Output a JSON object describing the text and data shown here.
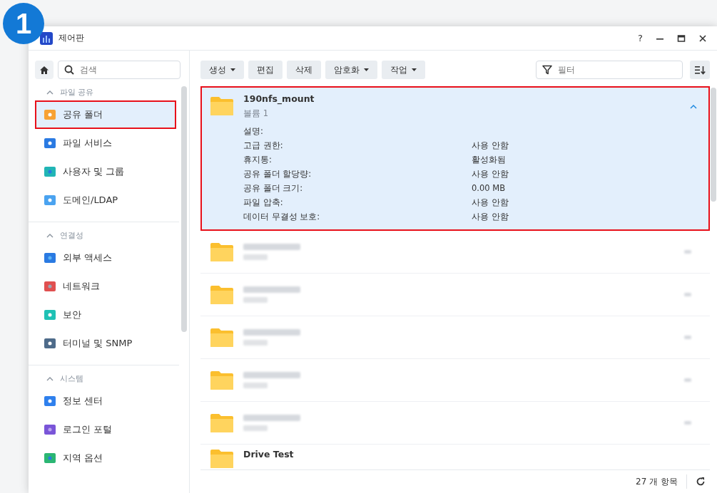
{
  "badge": "1",
  "window": {
    "title": "제어판",
    "help": "?"
  },
  "sidebar": {
    "search": {
      "placeholder": "검색"
    },
    "sections": [
      {
        "title": "파일 공유",
        "expanded": true,
        "items": [
          {
            "label": "공유 폴더",
            "selected": true,
            "highlighted": true
          },
          {
            "label": "파일 서비스",
            "selected": false,
            "highlighted": false
          },
          {
            "label": "사용자 및 그룹",
            "selected": false,
            "highlighted": false
          },
          {
            "label": "도메인/LDAP",
            "selected": false,
            "highlighted": false
          }
        ]
      },
      {
        "title": "연결성",
        "expanded": true,
        "items": [
          {
            "label": "외부 액세스",
            "selected": false,
            "highlighted": false
          },
          {
            "label": "네트워크",
            "selected": false,
            "highlighted": false
          },
          {
            "label": "보안",
            "selected": false,
            "highlighted": false
          },
          {
            "label": "터미널 및 SNMP",
            "selected": false,
            "highlighted": false
          }
        ]
      },
      {
        "title": "시스템",
        "expanded": true,
        "items": [
          {
            "label": "정보 센터",
            "selected": false,
            "highlighted": false
          },
          {
            "label": "로그인 포털",
            "selected": false,
            "highlighted": false
          },
          {
            "label": "지역 옵션",
            "selected": false,
            "highlighted": false
          }
        ]
      }
    ]
  },
  "toolbar": {
    "buttons": [
      {
        "label": "생성",
        "dropdown": true
      },
      {
        "label": "편집",
        "dropdown": false
      },
      {
        "label": "삭제",
        "dropdown": false
      },
      {
        "label": "암호화",
        "dropdown": true
      },
      {
        "label": "작업",
        "dropdown": true
      }
    ],
    "filter": {
      "placeholder": "필터"
    }
  },
  "folders": [
    {
      "kind": "expanded",
      "name": "190nfs_mount",
      "volume": "볼륨 1",
      "highlighted": true,
      "details": [
        {
          "label": "설명:"
        },
        {
          "label": "고급 권한:",
          "value": "사용 안함"
        },
        {
          "label": "휴지통:",
          "value": "활성화됨"
        },
        {
          "label": "공유 폴더 할당량:",
          "value": "사용 안함"
        },
        {
          "label": "공유 폴더 크기:",
          "value": "0.00 MB"
        },
        {
          "label": "파일 압축:",
          "value": "사용 안함"
        },
        {
          "label": "데이터 무결성 보호:",
          "value": "사용 안함"
        }
      ]
    },
    {
      "kind": "blurred"
    },
    {
      "kind": "blurred"
    },
    {
      "kind": "blurred"
    },
    {
      "kind": "blurred"
    },
    {
      "kind": "blurred"
    },
    {
      "kind": "partial",
      "name": "Drive Test"
    }
  ],
  "status_bar": {
    "count": "27 개 항목"
  }
}
